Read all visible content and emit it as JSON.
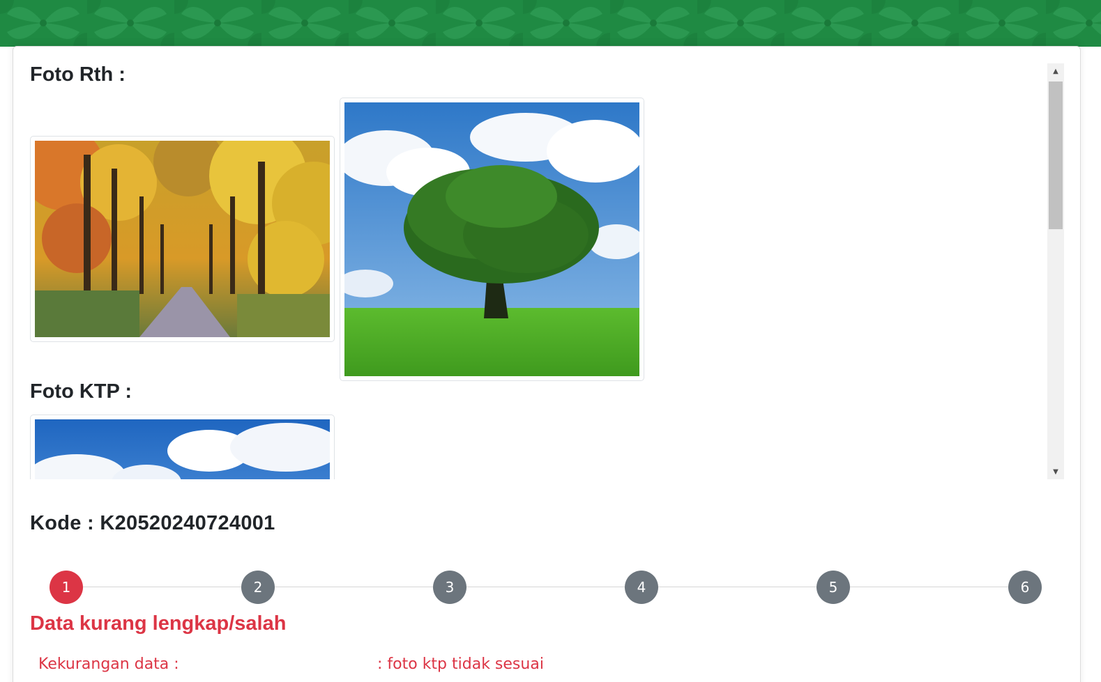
{
  "theme": {
    "banner_color": "#1f8a43",
    "danger": "#dc3545",
    "step_inactive": "#6c757d"
  },
  "photos": {
    "rth_title": "Foto Rth :",
    "rth_images": [
      {
        "icon": "autumn-tree-road-photo"
      },
      {
        "icon": "single-tree-field-photo"
      }
    ],
    "ktp_title": "Foto KTP :",
    "ktp_images": [
      {
        "icon": "sky-clouds-photo"
      }
    ]
  },
  "kode": "Kode : K20520240724001",
  "stepper": {
    "steps": [
      "1",
      "2",
      "3",
      "4",
      "5",
      "6"
    ],
    "active_step": 1
  },
  "status": {
    "title": "Data kurang lengkap/salah",
    "label": "Kekurangan data :",
    "value": ": foto ktp tidak sesuai"
  }
}
